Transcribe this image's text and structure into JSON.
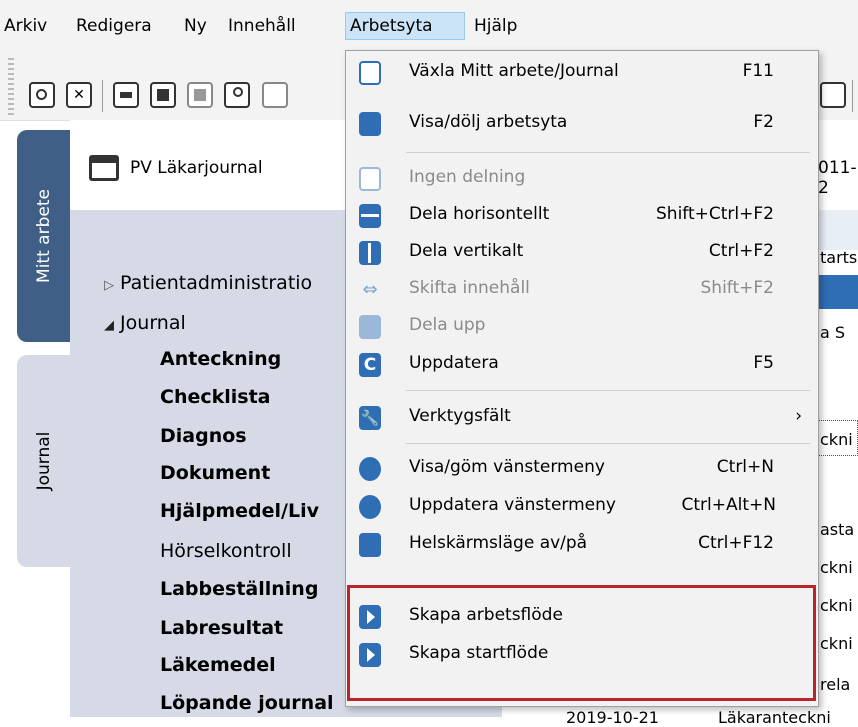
{
  "menubar": {
    "items": [
      "Arkiv",
      "Redigera",
      "Ny",
      "Innehåll",
      "Arbetsyta",
      "Hjälp"
    ],
    "active": "Arbetsyta"
  },
  "side_tabs": {
    "tab1": "Mitt arbete",
    "tab2": "Journal"
  },
  "header": {
    "title": "PV Läkarjournal",
    "date_fragment": "011-2"
  },
  "tree": {
    "patientadmin": "Patientadministratio",
    "journal": "Journal",
    "items": [
      "Anteckning",
      "Checklista",
      "Diagnos",
      "Dokument",
      "Hjälpmedel/Liv",
      "Hörselkontroll",
      "Labbeställning",
      "Labresultat",
      "Läkemedel",
      "Löpande journal"
    ]
  },
  "right_fragments": [
    "tarts",
    "a  S",
    "ckni",
    "asta",
    "ckni",
    "ckni",
    "ckni",
    "rela",
    "2019-10-21",
    "Läkaranteckni"
  ],
  "menu": {
    "items": [
      {
        "label": "Växla Mitt arbete/Journal",
        "shortcut": "F11",
        "icon": "journal-toggle-icon",
        "disabled": false
      },
      {
        "label": "Visa/dölj arbetsyta",
        "shortcut": "F2",
        "icon": "workspace-icon",
        "disabled": false
      },
      {
        "label": "Ingen delning",
        "shortcut": "",
        "icon": "no-split-icon",
        "disabled": true
      },
      {
        "label": "Dela horisontellt",
        "shortcut": "Shift+Ctrl+F2",
        "icon": "split-horizontal-icon",
        "disabled": false
      },
      {
        "label": "Dela vertikalt",
        "shortcut": "Ctrl+F2",
        "icon": "split-vertical-icon",
        "disabled": false
      },
      {
        "label": "Skifta innehåll",
        "shortcut": "Shift+F2",
        "icon": "swap-icon",
        "disabled": true
      },
      {
        "label": "Dela upp",
        "shortcut": "",
        "icon": "unsplit-icon",
        "disabled": true
      },
      {
        "label": "Uppdatera",
        "shortcut": "F5",
        "icon": "refresh-icon",
        "disabled": false
      },
      {
        "label": "Verktygsfält",
        "shortcut": "›",
        "icon": "wrench-icon",
        "disabled": false
      },
      {
        "label": "Visa/göm vänstermeny",
        "shortcut": "Ctrl+N",
        "icon": "leftmenu-icon",
        "disabled": false
      },
      {
        "label": "Uppdatera vänstermeny",
        "shortcut": "Ctrl+Alt+N",
        "icon": "refresh-leftmenu-icon",
        "disabled": false
      },
      {
        "label": "Helskärmsläge av/på",
        "shortcut": "Ctrl+F12",
        "icon": "fullscreen-icon",
        "disabled": false
      },
      {
        "label": "Skapa arbetsflöde",
        "shortcut": "",
        "icon": "workflow-icon",
        "disabled": false
      },
      {
        "label": "Skapa startflöde",
        "shortcut": "",
        "icon": "startflow-icon",
        "disabled": false
      }
    ]
  },
  "colors": {
    "accent": "#2f6db5",
    "highlight_border": "#b8262c",
    "menu_active": "#cce4f7",
    "sidebar_tab": "#3f5f86"
  }
}
